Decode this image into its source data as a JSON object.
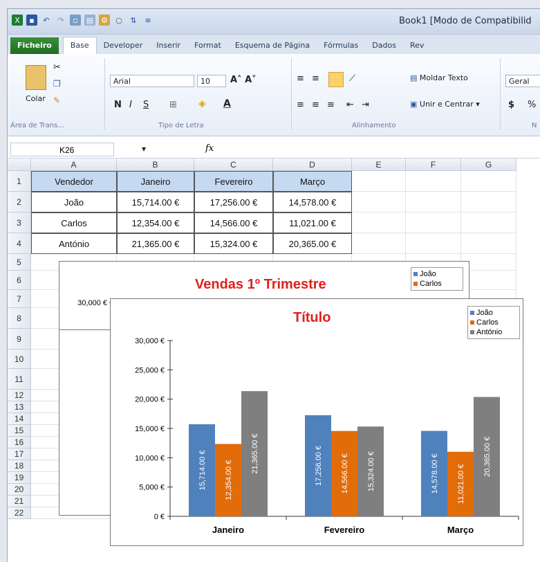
{
  "window_title": "Book1  [Modo de Compatibilid",
  "tabs": [
    "Ficheiro",
    "Base",
    "Developer",
    "Inserir",
    "Format",
    "Esquema de Página",
    "Fórmulas",
    "Dados",
    "Rev"
  ],
  "ribbon": {
    "paste_label": "Colar",
    "clipboard_group": "Área de Trans...",
    "font_name": "Arial",
    "font_size": "10",
    "bold": "N",
    "italic": "I",
    "underline": "S",
    "font_group": "Tipo de Letra",
    "wrap_text": "Moldar Texto",
    "merge_center": "Unir e Centrar",
    "alignment_group": "Alinhamento",
    "number_format": "Geral",
    "currency": "$",
    "percent": "%",
    "number_group": "N"
  },
  "formula_bar": {
    "name_box": "K26",
    "fx": "fx",
    "value": ""
  },
  "columns": [
    "A",
    "B",
    "C",
    "D",
    "E",
    "F",
    "G"
  ],
  "rows": [
    "1",
    "2",
    "3",
    "4",
    "5",
    "6",
    "7",
    "8",
    "9",
    "10",
    "11",
    "12",
    "13",
    "14",
    "15",
    "16",
    "17",
    "18",
    "19",
    "20",
    "21",
    "22"
  ],
  "table": {
    "headers": [
      "Vendedor",
      "Janeiro",
      "Fevereiro",
      "Março"
    ],
    "rows": [
      [
        "João",
        "15,714.00 €",
        "17,256.00 €",
        "14,578.00 €"
      ],
      [
        "Carlos",
        "12,354.00 €",
        "14,566.00 €",
        "11,021.00 €"
      ],
      [
        "António",
        "21,365.00 €",
        "15,324.00 €",
        "20,365.00 €"
      ]
    ]
  },
  "chart_data": [
    {
      "type": "bar",
      "title": "Vendas 1º Trimestre",
      "y_ticks": [
        "30,000 €",
        "25,000 €",
        "20,000 €",
        "15,000 €",
        "10,000 €",
        "5,000 €",
        "0 €"
      ],
      "legend": [
        "João",
        "Carlos"
      ]
    },
    {
      "type": "bar",
      "title": "Título",
      "categories": [
        "Janeiro",
        "Fevereiro",
        "Março"
      ],
      "series": [
        {
          "name": "João",
          "values": [
            15714,
            17256,
            14578
          ],
          "labels": [
            "15,714.00 €",
            "17,256.00 €",
            "14,578.00 €"
          ],
          "color": "#4f81bd"
        },
        {
          "name": "Carlos",
          "values": [
            12354,
            14566,
            11021
          ],
          "labels": [
            "12,354.00 €",
            "14,566.00 €",
            "11,021.00 €"
          ],
          "color": "#e36c0a"
        },
        {
          "name": "António",
          "values": [
            21365,
            15324,
            20365
          ],
          "labels": [
            "21,365.00 €",
            "15,324.00 €",
            "20,365.00 €"
          ],
          "color": "#7f7f7f"
        }
      ],
      "y_ticks": [
        "30,000 €",
        "25,000 €",
        "20,000 €",
        "15,000 €",
        "10,000 €",
        "5,000 €",
        "0 €"
      ],
      "ylim": [
        0,
        30000
      ],
      "legend_position": "top-right"
    }
  ]
}
